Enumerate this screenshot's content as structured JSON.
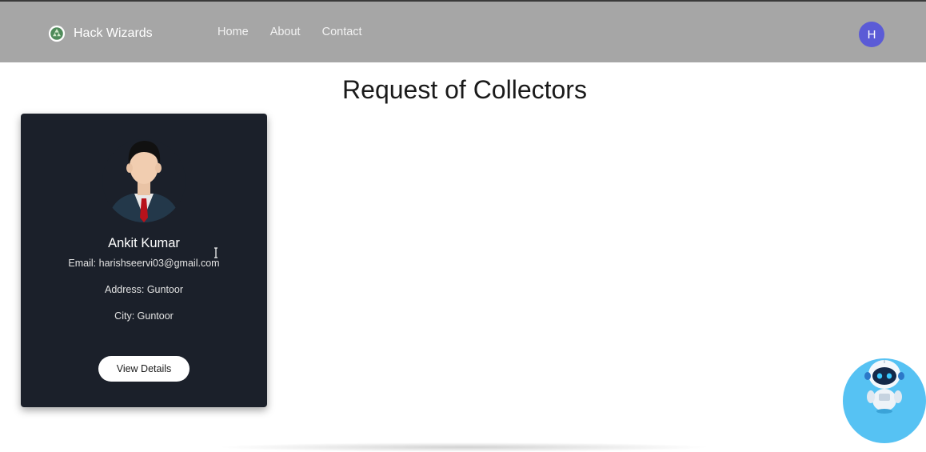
{
  "navbar": {
    "brand": "Hack Wizards",
    "links": [
      "Home",
      "About",
      "Contact"
    ],
    "avatar_initial": "H"
  },
  "page": {
    "title": "Request of Collectors"
  },
  "collectors": [
    {
      "name": "Ankit Kumar",
      "email": "Email: harishseervi03@gmail.com",
      "address": "Address: Guntoor",
      "city": "City: Guntoor",
      "button": "View Details"
    }
  ],
  "icons": {
    "brand": "recycle-logo-icon",
    "profile": "user-avatar-icon",
    "chatbot": "robot-chatbot-icon"
  },
  "colors": {
    "navbar_bg": "#a6a6a6",
    "card_bg": "#1b202a",
    "avatar_bg": "#5b5bd6",
    "chatbot_bg": "#56c2f3"
  }
}
